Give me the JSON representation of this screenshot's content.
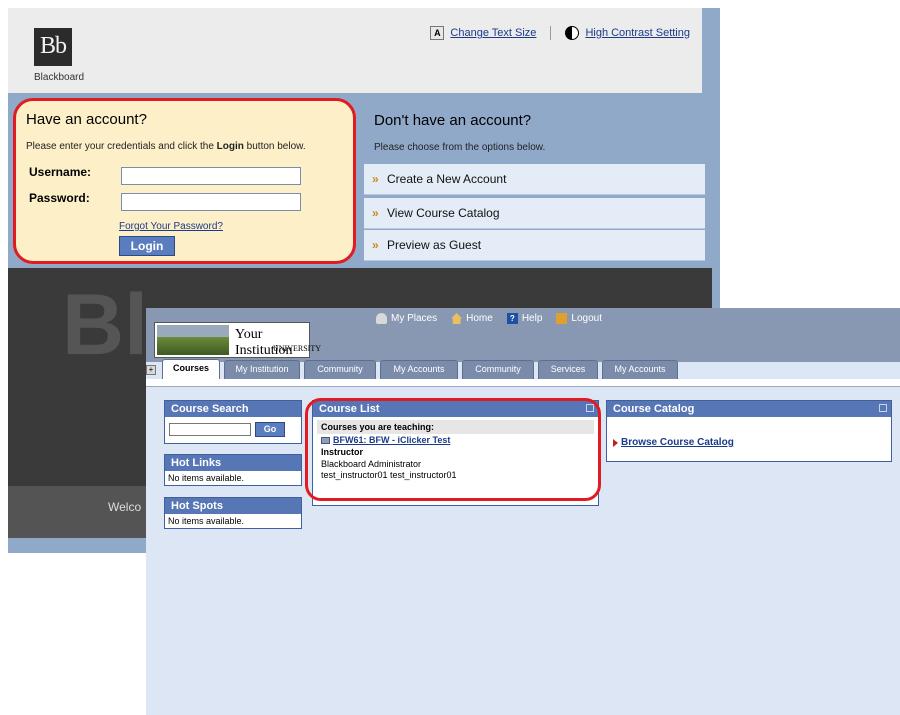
{
  "login_page": {
    "logo_text": "Bb",
    "brand": "Blackboard",
    "header_links": [
      "Change Text Size",
      "High Contrast Setting"
    ],
    "have_account": {
      "title": "Have an account?",
      "hint_prefix": "Please enter your credentials and click the ",
      "hint_bold": "Login",
      "hint_suffix": " button below.",
      "username_label": "Username:",
      "password_label": "Password:",
      "forgot_link": "Forgot Your Password?",
      "login_button": "Login"
    },
    "no_account": {
      "title": "Don't have an account?",
      "hint": "Please choose from the options below.",
      "options": [
        "Create a New Account",
        "View Course Catalog",
        "Preview as Guest"
      ]
    },
    "watermark": "Bl",
    "welcome_partial": "Welco"
  },
  "portal": {
    "institution_name": "Your Institution",
    "institution_sub": "UNIVERSITY",
    "top_links": [
      "My Places",
      "Home",
      "Help",
      "Logout"
    ],
    "tabs": [
      "Courses",
      "My Institution",
      "Community",
      "My Accounts",
      "Community",
      "Services",
      "My Accounts"
    ],
    "active_tab": "Courses",
    "course_search": {
      "title": "Course Search",
      "go_label": "Go"
    },
    "hot_links": {
      "title": "Hot Links",
      "body": "No items available."
    },
    "hot_spots": {
      "title": "Hot Spots",
      "body": "No items available."
    },
    "course_list": {
      "title": "Course List",
      "teaching_label": "Courses you are teaching:",
      "course": "BFW61: BFW - iClicker Test",
      "role": "Instructor",
      "instructors": [
        "Blackboard Administrator",
        "test_instructor01 test_instructor01"
      ]
    },
    "course_catalog": {
      "title": "Course Catalog",
      "link": "Browse Course Catalog"
    }
  },
  "colors": {
    "accent": "#5776b5",
    "highlight": "#e01b22",
    "login_bg": "#fdf0c8"
  }
}
